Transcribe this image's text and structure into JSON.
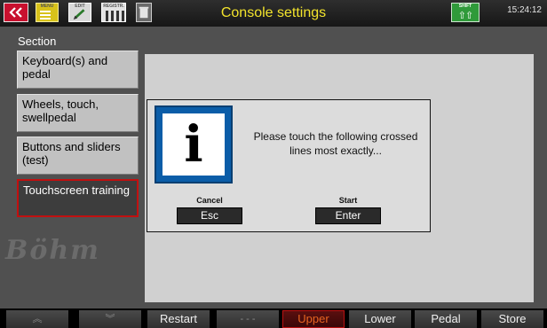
{
  "header": {
    "title": "Console settings",
    "clock": "15:24:12",
    "icons": [
      {
        "name": "back-icon",
        "label": ""
      },
      {
        "name": "menu-icon",
        "label": "MENU"
      },
      {
        "name": "edit-icon",
        "label": "EDIT"
      },
      {
        "name": "registration-icon",
        "label": "REGISTR."
      },
      {
        "name": "trash-icon",
        "label": ""
      },
      {
        "name": "shift-icon",
        "label": "SHIFT"
      }
    ]
  },
  "sidebar": {
    "section_label": "Section",
    "items": [
      {
        "label": "Keyboard(s) and pedal",
        "active": false
      },
      {
        "label": "Wheels, touch, swellpedal",
        "active": false
      },
      {
        "label": "Buttons and sliders (test)",
        "active": false
      },
      {
        "label": "Touchscreen training",
        "active": true
      }
    ]
  },
  "watermark": "Böhm",
  "dialog": {
    "icon": "info-icon",
    "icon_glyph": "i",
    "message": "Please touch the following crossed lines most exactly...",
    "cancel_label": "Cancel",
    "cancel_button": "Esc",
    "start_label": "Start",
    "start_button": "Enter"
  },
  "bottombar": {
    "buttons": [
      {
        "label": "︽",
        "icon": "scroll-up-icon"
      },
      {
        "label": "︾",
        "icon": "scroll-down-icon"
      },
      {
        "label": "Restart"
      },
      {
        "label": "- - -"
      },
      {
        "label": "Upper",
        "selected": true
      },
      {
        "label": "Lower"
      },
      {
        "label": "Pedal"
      },
      {
        "label": "Store"
      }
    ]
  },
  "colors": {
    "title": "#f2e32c",
    "accent_red": "#c11010",
    "info_blue": "#0b5da8",
    "upper_text": "#e86420"
  }
}
